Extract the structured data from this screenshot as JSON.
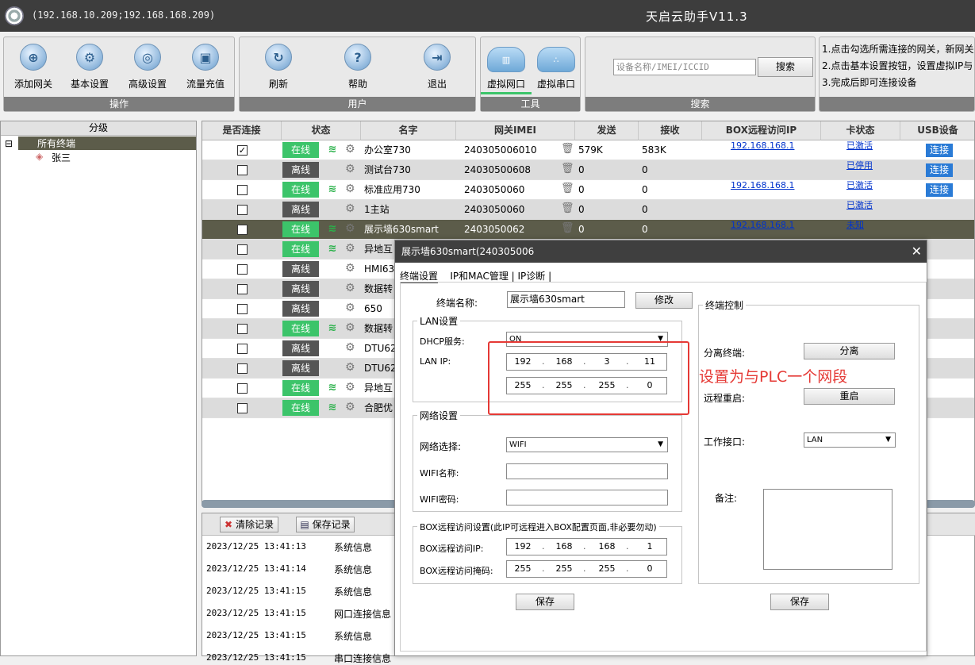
{
  "titlebar": {
    "ip": "(192.168.10.209;192.168.168.209)",
    "title": "天启云助手V11.3"
  },
  "toolbar": {
    "ops": {
      "caption": "操作",
      "buttons": [
        "添加网关",
        "基本设置",
        "高级设置",
        "流量充值"
      ]
    },
    "user": {
      "caption": "用户",
      "buttons": [
        "刷新",
        "帮助",
        "退出"
      ]
    },
    "tools": {
      "caption": "工具",
      "buttons": [
        "虚拟网口",
        "虚拟串口"
      ]
    },
    "search": {
      "caption": "搜索",
      "placeholder": "设备名称/IMEI/ICCID",
      "button": "搜索"
    },
    "tips": [
      "1.点击勾选所需连接的网关，新网关",
      "2.点击基本设置按钮，设置虚拟IP与",
      "3.完成后即可连接设备"
    ]
  },
  "tree": {
    "header": "分级",
    "root": "所有终端",
    "child": "张三"
  },
  "grid": {
    "columns": [
      "是否连接",
      "状态",
      "名字",
      "网关IMEI",
      "发送",
      "接收",
      "BOX远程访问IP",
      "卡状态",
      "USB设备"
    ],
    "rows": [
      {
        "checked": true,
        "status": "在线",
        "name": "办公室730",
        "imei": "240305006010",
        "send": "579K",
        "recv": "583K",
        "ip": "192.168.168.1",
        "card": "已激活",
        "usb": "连接",
        "wifi": true
      },
      {
        "checked": false,
        "status": "离线",
        "name": "测试台730",
        "imei": "24030500608",
        "send": "0",
        "recv": "0",
        "ip": "",
        "card": "已停用",
        "usb": "连接",
        "wifi": false
      },
      {
        "checked": false,
        "status": "在线",
        "name": "标准应用730",
        "imei": "2403050060",
        "send": "0",
        "recv": "0",
        "ip": "192.168.168.1",
        "card": "已激活",
        "usb": "连接",
        "wifi": true
      },
      {
        "checked": false,
        "status": "离线",
        "name": "1主站",
        "imei": "2403050060",
        "send": "0",
        "recv": "0",
        "ip": "",
        "card": "已激活",
        "usb": "",
        "wifi": false
      },
      {
        "checked": false,
        "status": "在线",
        "name": "展示墙630smart",
        "imei": "2403050062",
        "send": "0",
        "recv": "0",
        "ip": "192.168.168.1",
        "card": "未知",
        "usb": "",
        "wifi": true
      },
      {
        "checked": false,
        "status": "在线",
        "name": "异地互",
        "imei": "",
        "send": "",
        "recv": "",
        "ip": "",
        "card": "",
        "usb": "",
        "wifi": true
      },
      {
        "checked": false,
        "status": "离线",
        "name": "HMI63",
        "imei": "",
        "send": "",
        "recv": "",
        "ip": "",
        "card": "",
        "usb": "",
        "wifi": false
      },
      {
        "checked": false,
        "status": "离线",
        "name": "数据转",
        "imei": "",
        "send": "",
        "recv": "",
        "ip": "",
        "card": "",
        "usb": "",
        "wifi": false
      },
      {
        "checked": false,
        "status": "离线",
        "name": "650",
        "imei": "",
        "send": "",
        "recv": "",
        "ip": "",
        "card": "",
        "usb": "",
        "wifi": false
      },
      {
        "checked": false,
        "status": "在线",
        "name": "数据转",
        "imei": "",
        "send": "",
        "recv": "",
        "ip": "",
        "card": "",
        "usb": "",
        "wifi": true
      },
      {
        "checked": false,
        "status": "离线",
        "name": "DTU62",
        "imei": "",
        "send": "",
        "recv": "",
        "ip": "",
        "card": "",
        "usb": "",
        "wifi": false
      },
      {
        "checked": false,
        "status": "离线",
        "name": "DTU62",
        "imei": "",
        "send": "",
        "recv": "",
        "ip": "",
        "card": "",
        "usb": "",
        "wifi": false
      },
      {
        "checked": false,
        "status": "在线",
        "name": "异地互",
        "imei": "",
        "send": "",
        "recv": "",
        "ip": "",
        "card": "",
        "usb": "",
        "wifi": true
      },
      {
        "checked": false,
        "status": "在线",
        "name": "合肥优",
        "imei": "",
        "send": "",
        "recv": "",
        "ip": "",
        "card": "",
        "usb": "",
        "wifi": true
      }
    ]
  },
  "log": {
    "clear": "清除记录",
    "save": "保存记录",
    "rows": [
      {
        "time": "2023/12/25 13:41:13",
        "type": "系统信息"
      },
      {
        "time": "2023/12/25 13:41:14",
        "type": "系统信息"
      },
      {
        "time": "2023/12/25 13:41:15",
        "type": "系统信息"
      },
      {
        "time": "2023/12/25 13:41:15",
        "type": "网口连接信息"
      },
      {
        "time": "2023/12/25 13:41:15",
        "type": "系统信息"
      },
      {
        "time": "2023/12/25 13:41:15",
        "type": "串口连接信息"
      }
    ]
  },
  "dialog": {
    "title": "展示墙630smart(240305006",
    "tabs": [
      "终端设置",
      "IP和MAC管理",
      "IP诊断"
    ],
    "name_label": "终端名称:",
    "name_value": "展示墙630smart",
    "modify": "修改",
    "lan_title": "LAN设置",
    "dhcp_label": "DHCP服务:",
    "dhcp_value": "ON",
    "lanip_label": "LAN IP:",
    "lanip": [
      "192",
      "168",
      "3",
      "11"
    ],
    "lanmask": [
      "255",
      "255",
      "255",
      "0"
    ],
    "net_title": "网络设置",
    "net_select_label": "网络选择:",
    "net_select_value": "WIFI",
    "wifi_name_label": "WIFI名称:",
    "wifi_pwd_label": "WIFI密码:",
    "box_title": "BOX远程访问设置(此IP可远程进入BOX配置页面,非必要勿动)",
    "box_ip_label": "BOX远程访问IP:",
    "box_ip": [
      "192",
      "168",
      "168",
      "1"
    ],
    "box_mask_label": "BOX远程访问掩码:",
    "box_mask": [
      "255",
      "255",
      "255",
      "0"
    ],
    "save": "保存",
    "ctrl_title": "终端控制",
    "detach_label": "分离终端:",
    "detach_btn": "分离",
    "reboot_label": "远程重启:",
    "reboot_btn": "重启",
    "iface_label": "工作接口:",
    "iface_value": "LAN",
    "note_label": "备注:",
    "save2": "保存"
  },
  "annotation": "设置为与PLC一个网段"
}
